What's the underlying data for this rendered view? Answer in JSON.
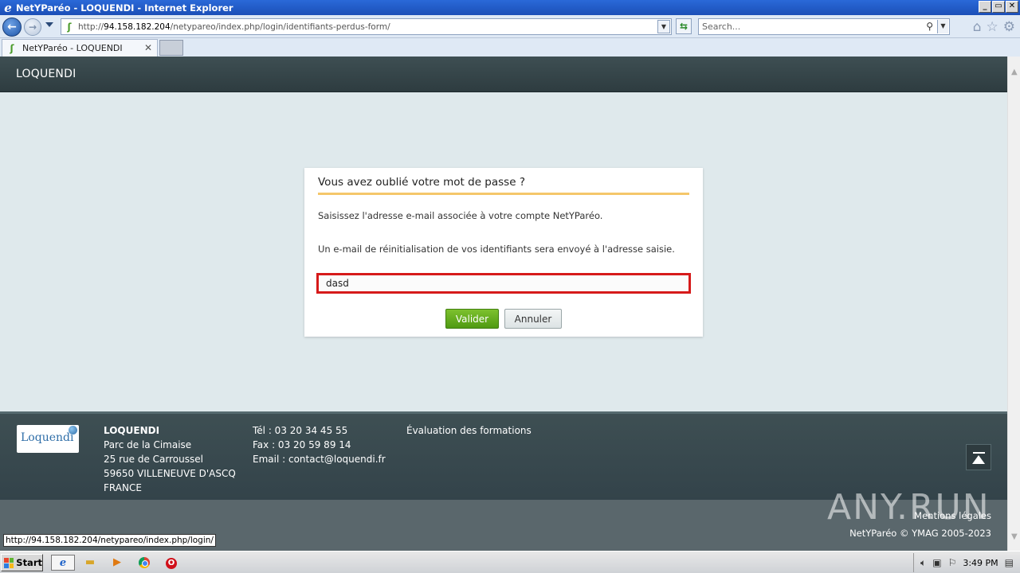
{
  "window": {
    "title": "NetYParéo - LOQUENDI - Internet Explorer",
    "controls": {
      "minimize": "_",
      "restore": "▭",
      "close": "✕"
    }
  },
  "browser": {
    "url_prefix": "http://",
    "url_host": "94.158.182.204",
    "url_path": "/netypareo/index.php/login/identifiants-perdus-form/",
    "search_placeholder": "Search...",
    "tab_title": "NetYParéo - LOQUENDI",
    "tab_close": "✕",
    "status_url": "http://94.158.182.204/netypareo/index.php/login/"
  },
  "header": {
    "brand": "LOQUENDI"
  },
  "form": {
    "title": "Vous avez oublié votre mot de passe ?",
    "instruction": "Saisissez l'adresse e-mail associée à votre compte NetYParéo.",
    "info": "Un e-mail de réinitialisation de vos identifiants sera envoyé à l'adresse saisie.",
    "email_value": "dasd",
    "submit_label": "Valider",
    "cancel_label": "Annuler",
    "accent_color": "#f5c76a",
    "error_border_color": "#d61a1a"
  },
  "footer": {
    "logo_text": "Loquendi",
    "address": {
      "name": "LOQUENDI",
      "line1": "Parc de la Cimaise",
      "line2": "25 rue de Carroussel",
      "line3": "59650 VILLENEUVE D'ASCQ",
      "line4": "FRANCE"
    },
    "contact": {
      "tel": "Tél : 03 20 34 45 55",
      "fax": "Fax : 03 20 59 89 14",
      "email": "Email : contact@loquendi.fr"
    },
    "link": "Évaluation des formations",
    "mentions": "Mentions légales",
    "copyright": "NetYParéo © YMAG 2005-2023"
  },
  "watermark": "ANY.RUN",
  "taskbar": {
    "start_label": "Start",
    "clock": "3:49 PM"
  }
}
